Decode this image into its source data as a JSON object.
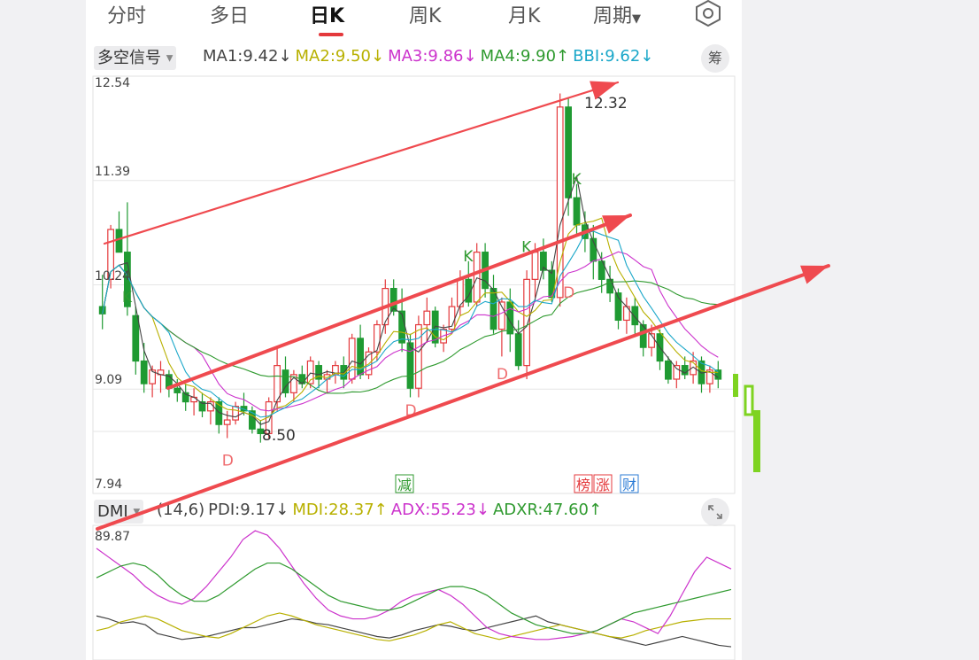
{
  "tabs": [
    {
      "label": "分时"
    },
    {
      "label": "多日"
    },
    {
      "label": "日K"
    },
    {
      "label": "周K"
    },
    {
      "label": "月K"
    },
    {
      "label": "周期"
    }
  ],
  "active_tab": "日K",
  "settings_icon": "hexagon-gear-icon",
  "main_indicator": {
    "selector": "多空信号",
    "items": [
      {
        "label": "MA1:",
        "value": "9.42",
        "arrow": "↓",
        "color": "#444444"
      },
      {
        "label": "MA2:",
        "value": "9.50",
        "arrow": "↓",
        "color": "#b8b000"
      },
      {
        "label": "MA3:",
        "value": "9.86",
        "arrow": "↓",
        "color": "#cc33cc"
      },
      {
        "label": "MA4:",
        "value": "9.90",
        "arrow": "↑",
        "color": "#2f9a2f"
      },
      {
        "label": "BBI:",
        "value": "9.62",
        "arrow": "↓",
        "color": "#1aa7c9"
      }
    ],
    "chip_button": "筹"
  },
  "price_axis": {
    "labels": [
      "12.54",
      "11.39",
      "10.24",
      "9.09",
      "7.94"
    ]
  },
  "annotations": {
    "high": "12.32",
    "low": "8.50"
  },
  "event_tags": [
    {
      "text": "减",
      "color": "#2f9a2f"
    },
    {
      "text": "榜",
      "color": "#e4393c"
    },
    {
      "text": "涨",
      "color": "#e4393c"
    },
    {
      "text": "财",
      "color": "#2b7bd6"
    }
  ],
  "sub_indicator": {
    "selector": "DMI",
    "params": "(14,6)",
    "items": [
      {
        "label": "PDI:",
        "value": "9.17",
        "arrow": "↓",
        "color": "#444444"
      },
      {
        "label": "MDI:",
        "value": "28.37",
        "arrow": "↑",
        "color": "#b8b000"
      },
      {
        "label": "ADX:",
        "value": "55.23",
        "arrow": "↓",
        "color": "#cc33cc"
      },
      {
        "label": "ADXR:",
        "value": "47.60",
        "arrow": "↑",
        "color": "#2f9a2f"
      }
    ],
    "axis_top": "89.87",
    "expand_icon": "expand-arrows-icon"
  },
  "signals": {
    "buy": "K",
    "sell": "D"
  },
  "colors": {
    "up": "#e4393c",
    "down": "#1f9a32",
    "arrow": "#ef4a4f"
  },
  "chart_data": {
    "type": "candlestick",
    "ylim": [
      7.94,
      12.54
    ],
    "candles": [
      [
        10.0,
        10.35,
        9.75,
        9.92
      ],
      [
        10.3,
        10.9,
        10.2,
        10.85
      ],
      [
        10.85,
        11.05,
        10.7,
        10.6
      ],
      [
        10.6,
        11.15,
        9.9,
        10.0
      ],
      [
        9.9,
        10.0,
        9.25,
        9.4
      ],
      [
        9.4,
        9.6,
        9.05,
        9.15
      ],
      [
        9.15,
        9.35,
        9.0,
        9.3
      ],
      [
        9.25,
        9.4,
        9.05,
        9.3
      ],
      [
        9.25,
        9.3,
        9.0,
        9.1
      ],
      [
        9.1,
        9.2,
        8.95,
        9.05
      ],
      [
        9.05,
        9.15,
        8.85,
        8.95
      ],
      [
        8.95,
        9.1,
        8.8,
        9.0
      ],
      [
        8.95,
        9.05,
        8.78,
        8.85
      ],
      [
        8.85,
        9.0,
        8.7,
        8.95
      ],
      [
        8.95,
        9.0,
        8.6,
        8.7
      ],
      [
        8.7,
        8.85,
        8.55,
        8.75
      ],
      [
        8.75,
        8.95,
        8.7,
        8.9
      ],
      [
        8.9,
        9.05,
        8.8,
        8.85
      ],
      [
        8.85,
        8.9,
        8.6,
        8.65
      ],
      [
        8.65,
        8.75,
        8.5,
        8.6
      ],
      [
        8.6,
        9.0,
        8.55,
        8.95
      ],
      [
        8.95,
        9.55,
        8.85,
        9.35
      ],
      [
        9.3,
        9.45,
        9.0,
        9.05
      ],
      [
        9.05,
        9.3,
        8.95,
        9.25
      ],
      [
        9.25,
        9.35,
        9.1,
        9.15
      ],
      [
        9.15,
        9.45,
        9.1,
        9.4
      ],
      [
        9.35,
        9.4,
        9.1,
        9.2
      ],
      [
        9.2,
        9.3,
        9.05,
        9.25
      ],
      [
        9.25,
        9.4,
        9.15,
        9.35
      ],
      [
        9.35,
        9.45,
        9.1,
        9.2
      ],
      [
        9.2,
        9.7,
        9.15,
        9.65
      ],
      [
        9.65,
        9.8,
        9.2,
        9.25
      ],
      [
        9.25,
        9.55,
        9.2,
        9.5
      ],
      [
        9.5,
        9.85,
        9.4,
        9.8
      ],
      [
        9.8,
        10.3,
        9.7,
        10.2
      ],
      [
        10.2,
        10.3,
        9.9,
        9.95
      ],
      [
        9.95,
        10.2,
        9.5,
        9.6
      ],
      [
        9.6,
        9.7,
        9.0,
        9.1
      ],
      [
        9.1,
        9.9,
        9.0,
        9.8
      ],
      [
        9.8,
        10.1,
        9.6,
        9.95
      ],
      [
        9.95,
        10.0,
        9.55,
        9.6
      ],
      [
        9.6,
        9.8,
        9.5,
        9.75
      ],
      [
        9.75,
        10.1,
        9.7,
        10.0
      ],
      [
        10.0,
        10.4,
        9.9,
        10.3
      ],
      [
        10.3,
        10.5,
        10.0,
        10.05
      ],
      [
        10.05,
        10.7,
        10.0,
        10.6
      ],
      [
        10.6,
        10.7,
        10.1,
        10.2
      ],
      [
        10.2,
        10.35,
        9.7,
        9.75
      ],
      [
        9.75,
        10.1,
        9.45,
        10.05
      ],
      [
        10.05,
        10.2,
        9.5,
        9.7
      ],
      [
        9.7,
        9.85,
        9.3,
        9.35
      ],
      [
        9.35,
        10.4,
        9.2,
        10.3
      ],
      [
        10.3,
        10.7,
        10.1,
        10.6
      ],
      [
        10.6,
        10.75,
        10.3,
        10.4
      ],
      [
        10.4,
        10.5,
        10.05,
        10.1
      ],
      [
        10.1,
        12.35,
        10.0,
        12.2
      ],
      [
        12.2,
        12.3,
        11.0,
        11.2
      ],
      [
        11.2,
        11.35,
        10.8,
        10.9
      ],
      [
        10.9,
        11.05,
        10.6,
        10.75
      ],
      [
        10.75,
        10.9,
        10.3,
        10.5
      ],
      [
        10.5,
        10.6,
        10.15,
        10.3
      ],
      [
        10.3,
        10.45,
        10.05,
        10.15
      ],
      [
        10.15,
        10.2,
        9.75,
        9.85
      ],
      [
        9.85,
        10.1,
        9.7,
        10.0
      ],
      [
        10.0,
        10.1,
        9.7,
        9.8
      ],
      [
        9.8,
        9.85,
        9.45,
        9.55
      ],
      [
        9.55,
        9.8,
        9.45,
        9.7
      ],
      [
        9.7,
        9.75,
        9.3,
        9.4
      ],
      [
        9.4,
        9.45,
        9.15,
        9.2
      ],
      [
        9.2,
        9.4,
        9.1,
        9.35
      ],
      [
        9.35,
        9.45,
        9.2,
        9.25
      ],
      [
        9.25,
        9.5,
        9.15,
        9.4
      ],
      [
        9.4,
        9.45,
        9.05,
        9.15
      ],
      [
        9.15,
        9.35,
        9.05,
        9.3
      ],
      [
        9.3,
        9.4,
        9.1,
        9.2
      ]
    ],
    "dmi": {
      "ylim": [
        0,
        89.87
      ],
      "pdi": [
        30,
        28,
        25,
        26,
        24,
        18,
        16,
        14,
        15,
        16,
        18,
        20,
        22,
        22,
        24,
        26,
        28,
        27,
        25,
        24,
        22,
        20,
        18,
        16,
        15,
        17,
        20,
        22,
        24,
        23,
        21,
        20,
        22,
        24,
        26,
        28,
        30,
        26,
        24,
        22,
        20,
        18,
        16,
        14,
        12,
        10,
        12,
        14,
        16,
        14,
        12,
        10,
        9
      ],
      "mdi": [
        20,
        22,
        26,
        28,
        30,
        28,
        24,
        20,
        18,
        16,
        15,
        18,
        22,
        26,
        30,
        32,
        30,
        27,
        24,
        22,
        20,
        18,
        16,
        14,
        13,
        15,
        17,
        20,
        24,
        26,
        22,
        18,
        16,
        14,
        16,
        18,
        20,
        22,
        24,
        22,
        20,
        18,
        16,
        15,
        17,
        20,
        22,
        24,
        26,
        27,
        28,
        28,
        28
      ],
      "adx": [
        76,
        70,
        64,
        58,
        50,
        44,
        40,
        38,
        42,
        50,
        60,
        70,
        82,
        88,
        85,
        76,
        64,
        52,
        42,
        34,
        30,
        28,
        28,
        30,
        34,
        40,
        44,
        46,
        48,
        44,
        38,
        30,
        22,
        18,
        16,
        15,
        14,
        14,
        15,
        16,
        18,
        20,
        24,
        28,
        26,
        22,
        18,
        30,
        45,
        60,
        70,
        66,
        62
      ],
      "adxr": [
        56,
        60,
        64,
        66,
        64,
        58,
        50,
        44,
        40,
        40,
        44,
        50,
        56,
        62,
        66,
        66,
        62,
        56,
        50,
        44,
        40,
        38,
        36,
        34,
        34,
        36,
        40,
        44,
        48,
        50,
        50,
        48,
        44,
        38,
        32,
        28,
        24,
        22,
        20,
        18,
        18,
        20,
        24,
        28,
        32,
        34,
        36,
        38,
        40,
        42,
        44,
        46,
        48
      ]
    }
  }
}
